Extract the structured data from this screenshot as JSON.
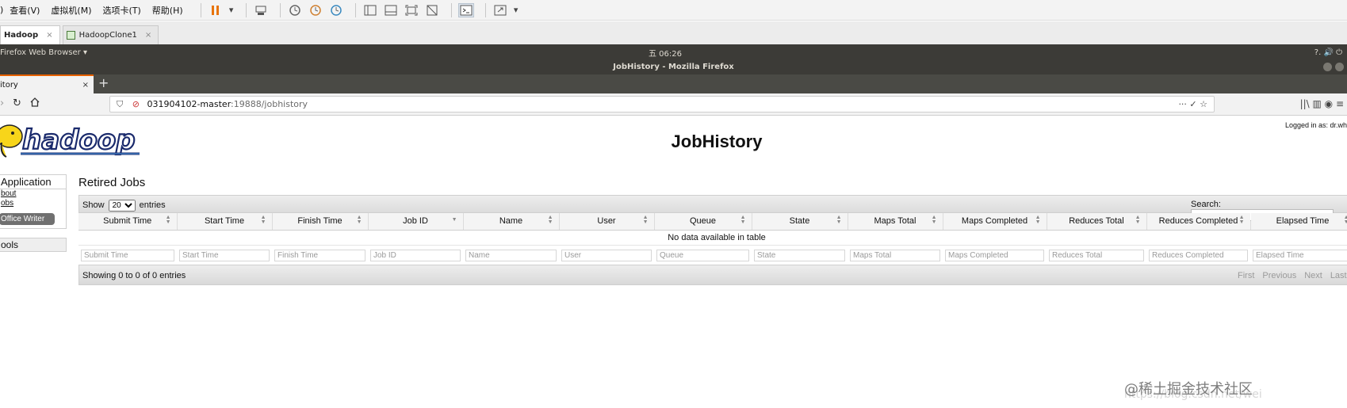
{
  "vm_menubar": {
    "leading": ")",
    "menus": [
      "查看(V)",
      "虚拟机(M)",
      "选项卡(T)",
      "帮助(H)"
    ]
  },
  "vm_tabs": [
    {
      "label": "Hadoop",
      "close": "×"
    },
    {
      "label": "HadoopClone1",
      "close": "×"
    }
  ],
  "ubuntu_bar": {
    "app_menu": "Firefox Web Browser ▾",
    "clock": "五 06:26",
    "sys_icons": "?. 🔊 ⏻"
  },
  "firefox": {
    "window_title": "JobHistory - Mozilla Firefox",
    "tab_label": "itory",
    "tab_close": "×",
    "new_tab": "+",
    "url_host": "031904102-master",
    "url_path": ":19888/jobhistory",
    "url_icons": "··· ✓ ☆",
    "toolbar_icons": "||\\ ▥ ◉ ≡"
  },
  "page": {
    "logo_text": "hadoop",
    "heading": "JobHistory",
    "logged_in": "Logged in as: dr.wh",
    "sidebar": {
      "application_header": "Application",
      "links": [
        "bout",
        "obs"
      ],
      "pill": "Office Writer",
      "tools_header": "ools"
    },
    "section_title": "Retired Jobs",
    "table": {
      "show_label": "Show",
      "entries_value": "20",
      "entries_label": "entries",
      "search_label": "Search:",
      "columns": [
        "Submit Time",
        "Start Time",
        "Finish Time",
        "Job ID",
        "Name",
        "User",
        "Queue",
        "State",
        "Maps Total",
        "Maps Completed",
        "Reduces Total",
        "Reduces Completed",
        "Elapsed Time"
      ],
      "empty_message": "No data available in table",
      "info": "Showing 0 to 0 of 0 entries",
      "pager": [
        "First",
        "Previous",
        "Next",
        "Last"
      ]
    }
  },
  "watermark": "@稀土掘金技术社区",
  "watermark_url": "https://blog.csdn.net/wei"
}
